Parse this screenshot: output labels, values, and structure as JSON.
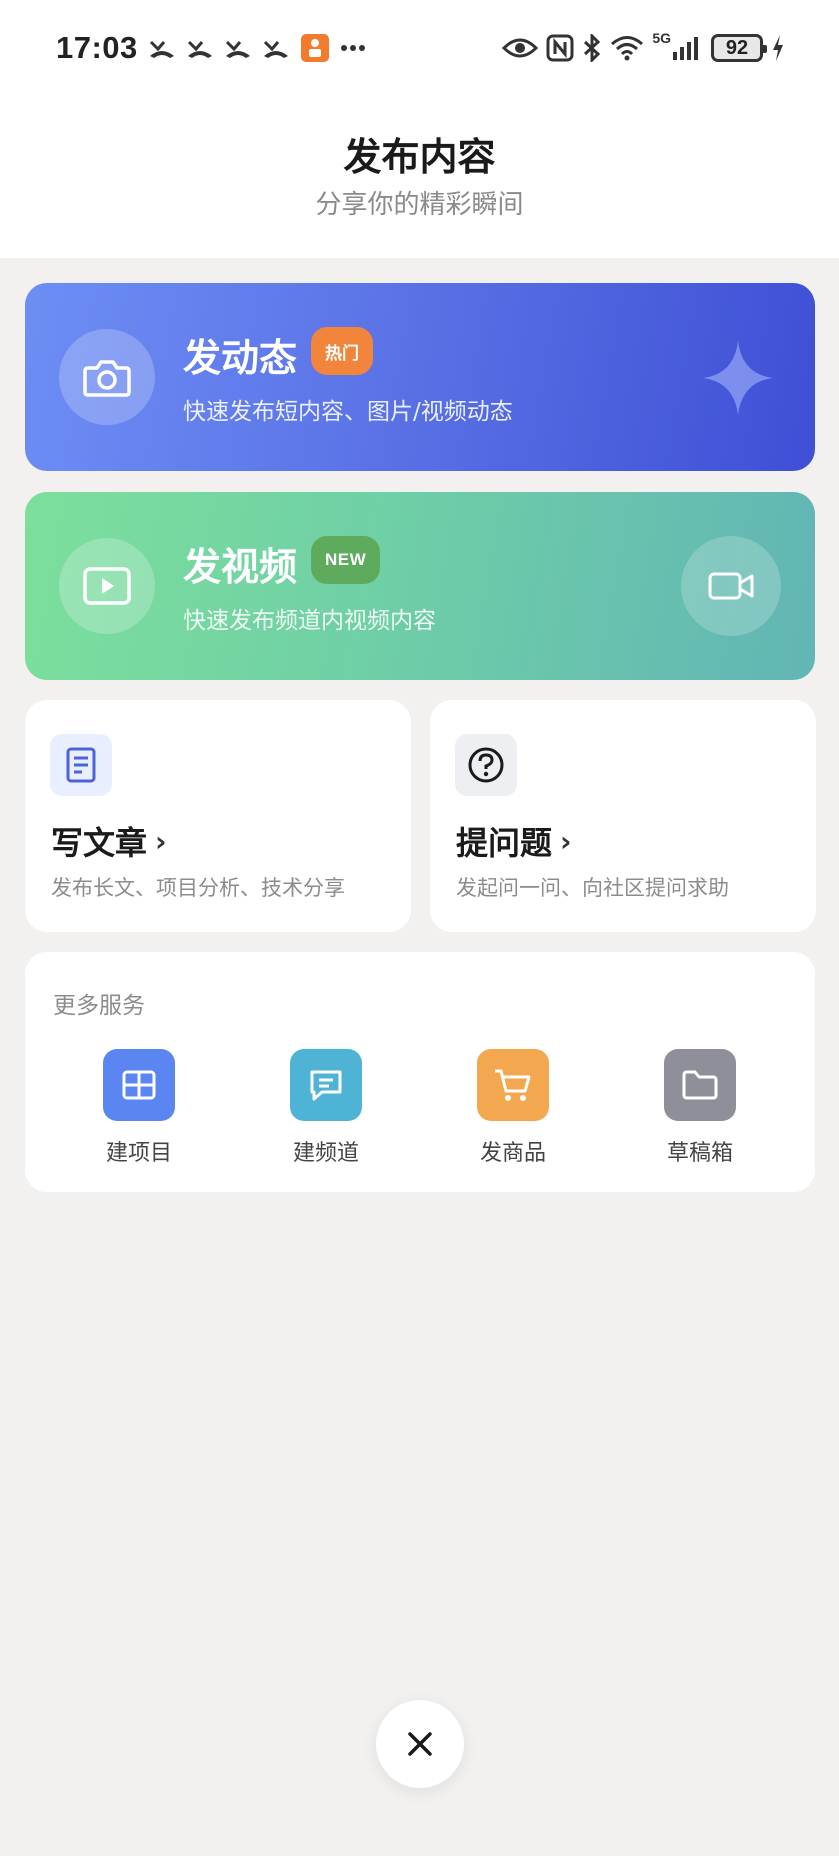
{
  "status_bar": {
    "time": "17:03",
    "notification_icons": [
      "missed-call-icon",
      "missed-call-icon",
      "missed-call-icon",
      "missed-call-icon",
      "app-notification-icon",
      "more-dots-icon"
    ],
    "network": "5G",
    "battery": "92"
  },
  "header": {
    "title": "发布内容",
    "subtitle": "分享你的精彩瞬间"
  },
  "post": {
    "title": "发动态",
    "badge": "热门",
    "description": "快速发布短内容、图片/视频动态",
    "icon": "camera-icon"
  },
  "video": {
    "title": "发视频",
    "badge": "NEW",
    "description": "快速发布频道内视频内容",
    "icon": "play-icon",
    "side_icon": "video-camera-icon"
  },
  "article": {
    "title": "写文章",
    "arrow": "›",
    "description": "发布长文、项目分析、技术分享",
    "icon": "document-icon"
  },
  "question": {
    "title": "提问题",
    "arrow": "›",
    "description": "发起问一问、向社区提问求助",
    "icon": "question-icon"
  },
  "services": {
    "title": "更多服务",
    "items": [
      {
        "label": "建项目",
        "icon": "project-grid-icon",
        "color": "#5b85f0"
      },
      {
        "label": "建频道",
        "icon": "channel-chat-icon",
        "color": "#4fb3d6"
      },
      {
        "label": "发商品",
        "icon": "shopping-cart-icon",
        "color": "#f3a84f"
      },
      {
        "label": "草稿箱",
        "icon": "folder-icon",
        "color": "#8e8f99"
      }
    ]
  },
  "close": {
    "label": "×"
  }
}
